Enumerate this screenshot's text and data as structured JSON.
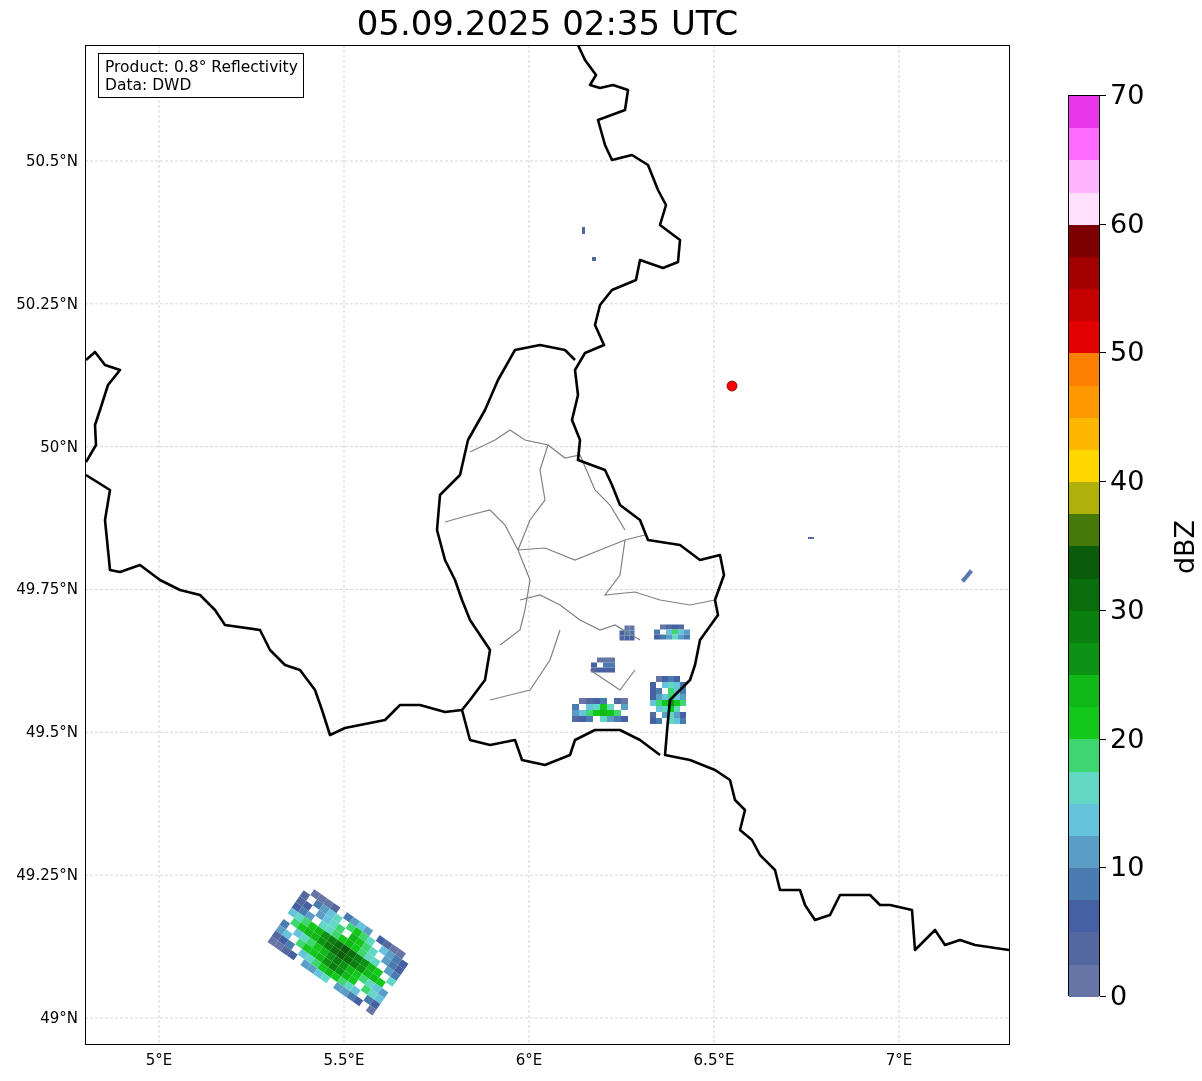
{
  "title": "05.09.2025 02:35 UTC",
  "legend": {
    "lines": [
      "Product: 0.8° Reflectivity",
      "Data: DWD"
    ]
  },
  "map": {
    "yticks": [
      "50.5°N",
      "50.25°N",
      "50°N",
      "49.75°N",
      "49.5°N",
      "49.25°N",
      "49°N"
    ],
    "xticks": [
      "5°E",
      "5.5°E",
      "6°E",
      "6.5°E",
      "7°E"
    ]
  },
  "colorbar": {
    "label": "dBZ",
    "ticks": [
      "70",
      "60",
      "50",
      "40",
      "30",
      "20",
      "10",
      "0"
    ],
    "segments": [
      {
        "color": "#ea36ea"
      },
      {
        "color": "#ff6cff"
      },
      {
        "color": "#ffb4ff"
      },
      {
        "color": "#ffe0ff"
      },
      {
        "color": "#7d0000"
      },
      {
        "color": "#a30000"
      },
      {
        "color": "#c40000"
      },
      {
        "color": "#e30000"
      },
      {
        "color": "#fe7e00"
      },
      {
        "color": "#fe9800"
      },
      {
        "color": "#feb700"
      },
      {
        "color": "#fed700"
      },
      {
        "color": "#afb00a"
      },
      {
        "color": "#46780a"
      },
      {
        "color": "#0a5c0a"
      },
      {
        "color": "#0a6e0d"
      },
      {
        "color": "#0b7e10"
      },
      {
        "color": "#0c9313"
      },
      {
        "color": "#10b918"
      },
      {
        "color": "#13c81a"
      },
      {
        "color": "#3dd670"
      },
      {
        "color": "#62d7c4"
      },
      {
        "color": "#66c3dc"
      },
      {
        "color": "#5a9ec5"
      },
      {
        "color": "#4a7bb0"
      },
      {
        "color": "#4560a3"
      },
      {
        "color": "#5468a0"
      },
      {
        "color": "#6674a6"
      }
    ]
  }
}
